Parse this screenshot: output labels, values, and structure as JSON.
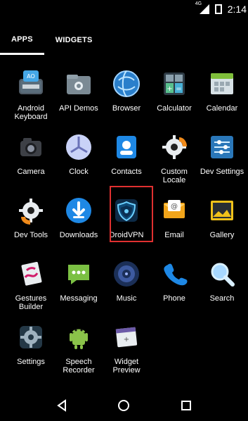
{
  "status": {
    "time": "2:14",
    "network": "4G"
  },
  "tabs": [
    {
      "label": "APPS",
      "active": true
    },
    {
      "label": "WIDGETS",
      "active": false
    }
  ],
  "apps": [
    {
      "label": "Android Keyboard",
      "icon": "keyboard-icon"
    },
    {
      "label": "API Demos",
      "icon": "settings-folder-icon"
    },
    {
      "label": "Browser",
      "icon": "globe-icon"
    },
    {
      "label": "Calculator",
      "icon": "calculator-icon"
    },
    {
      "label": "Calendar",
      "icon": "calendar-icon"
    },
    {
      "label": "Camera",
      "icon": "camera-icon"
    },
    {
      "label": "Clock",
      "icon": "clock-icon"
    },
    {
      "label": "Contacts",
      "icon": "contacts-icon"
    },
    {
      "label": "Custom Locale",
      "icon": "gear-icon"
    },
    {
      "label": "Dev Settings",
      "icon": "sliders-icon"
    },
    {
      "label": "Dev Tools",
      "icon": "gear-icon"
    },
    {
      "label": "Downloads",
      "icon": "download-icon"
    },
    {
      "label": "DroidVPN",
      "icon": "shield-icon"
    },
    {
      "label": "Email",
      "icon": "email-icon"
    },
    {
      "label": "Gallery",
      "icon": "gallery-icon"
    },
    {
      "label": "Gestures Builder",
      "icon": "gestures-icon"
    },
    {
      "label": "Messaging",
      "icon": "messaging-icon"
    },
    {
      "label": "Music",
      "icon": "music-icon"
    },
    {
      "label": "Phone",
      "icon": "phone-icon"
    },
    {
      "label": "Search",
      "icon": "search-icon"
    },
    {
      "label": "Settings",
      "icon": "settings-icon"
    },
    {
      "label": "Speech Recorder",
      "icon": "android-icon"
    },
    {
      "label": "Widget Preview",
      "icon": "widget-preview-icon"
    }
  ],
  "colors": {
    "highlight": "#e03030",
    "background": "#000000"
  }
}
